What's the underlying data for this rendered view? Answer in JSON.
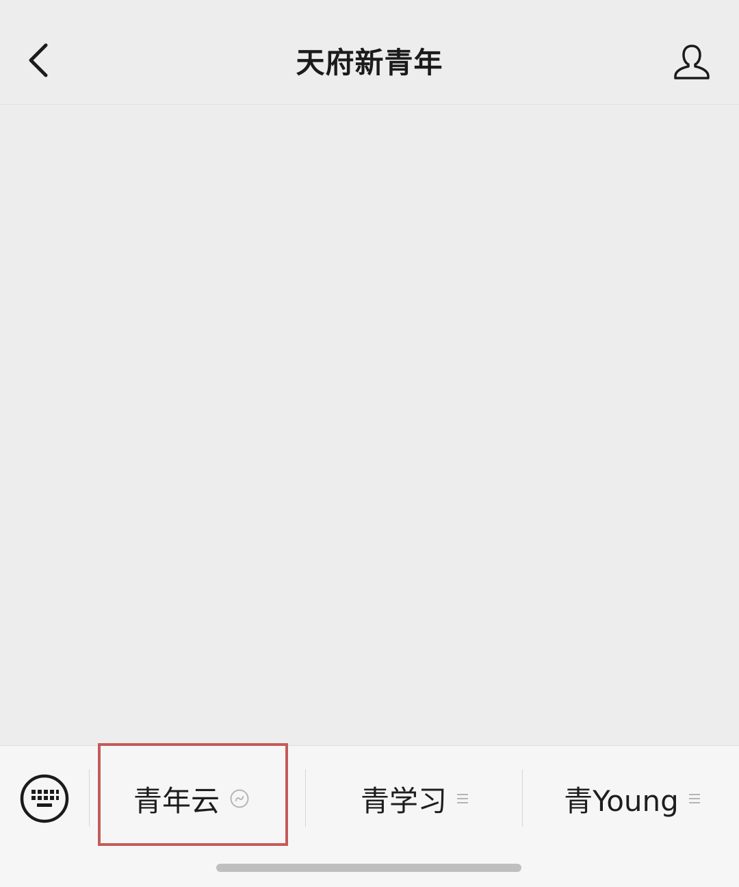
{
  "header": {
    "title": "天府新青年",
    "back_icon": "chevron-left-icon",
    "profile_icon": "person-icon"
  },
  "menu_bar": {
    "keyboard_icon": "keyboard-icon",
    "items": [
      {
        "label": "青年云",
        "icon": "mini-program-icon",
        "highlighted": true
      },
      {
        "label": "青学习",
        "icon": "submenu-icon",
        "highlighted": false
      },
      {
        "label": "青Young",
        "icon": "submenu-icon",
        "highlighted": false
      }
    ]
  },
  "colors": {
    "background": "#ededed",
    "menu_background": "#f7f6f6",
    "highlight": "#c55a5a",
    "text": "#1e1e1e"
  }
}
